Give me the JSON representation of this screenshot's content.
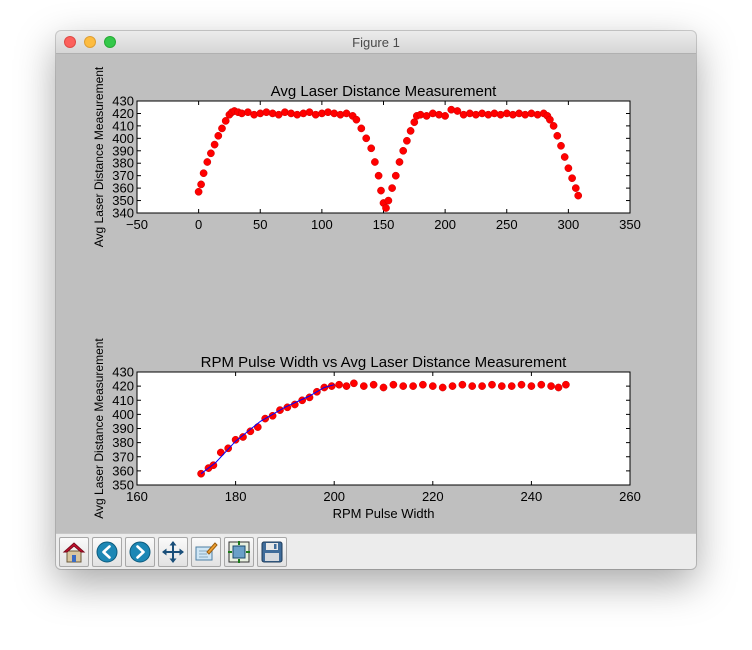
{
  "window": {
    "title": "Figure 1"
  },
  "toolbar": {
    "buttons": [
      {
        "name": "home-button",
        "icon": "home-icon"
      },
      {
        "name": "back-button",
        "icon": "back-arrow-icon"
      },
      {
        "name": "forward-button",
        "icon": "forward-arrow-icon"
      },
      {
        "name": "pan-button",
        "icon": "move-arrows-icon"
      },
      {
        "name": "zoom-button",
        "icon": "zoom-rect-icon"
      },
      {
        "name": "subplots-button",
        "icon": "subplots-config-icon"
      },
      {
        "name": "save-button",
        "icon": "floppy-disk-icon"
      }
    ]
  },
  "colors": {
    "figure_bg": "#bfbfbf",
    "axes_bg": "#ffffff",
    "marker": "#ff0000",
    "fit_line": "#0000ff"
  },
  "chart_data": [
    {
      "type": "scatter",
      "title": "Avg Laser Distance Measurement",
      "xlabel": "",
      "ylabel": "Avg Laser Distance Measurement",
      "xlim": [
        -50,
        350
      ],
      "ylim": [
        340,
        430
      ],
      "xticks": [
        -50,
        0,
        50,
        100,
        150,
        200,
        250,
        300,
        350
      ],
      "yticks": [
        340,
        350,
        360,
        370,
        380,
        390,
        400,
        410,
        420,
        430
      ],
      "grid": false,
      "series": [
        {
          "marker_color": "#ff0000",
          "x": [
            0,
            2,
            4,
            7,
            10,
            13,
            16,
            19,
            22,
            25,
            27,
            29,
            32,
            35,
            40,
            45,
            50,
            55,
            60,
            65,
            70,
            75,
            80,
            85,
            90,
            95,
            100,
            105,
            110,
            115,
            120,
            125,
            128,
            132,
            136,
            140,
            143,
            146,
            148,
            150,
            152,
            154,
            157,
            160,
            163,
            166,
            169,
            172,
            175,
            177,
            180,
            185,
            190,
            195,
            200,
            205,
            210,
            215,
            220,
            225,
            230,
            235,
            240,
            245,
            250,
            255,
            260,
            265,
            270,
            275,
            280,
            283,
            285,
            288,
            291,
            294,
            297,
            300,
            303,
            306,
            308
          ],
          "y": [
            357,
            363,
            372,
            381,
            388,
            395,
            402,
            408,
            414,
            419,
            421,
            422,
            421,
            420,
            421,
            419,
            420,
            421,
            420,
            419,
            421,
            420,
            419,
            420,
            421,
            419,
            420,
            421,
            420,
            419,
            420,
            418,
            415,
            408,
            400,
            392,
            381,
            370,
            358,
            348,
            344,
            350,
            360,
            370,
            381,
            390,
            398,
            406,
            413,
            418,
            419,
            418,
            420,
            419,
            418,
            423,
            422,
            419,
            420,
            419,
            420,
            419,
            420,
            419,
            420,
            419,
            420,
            419,
            420,
            419,
            420,
            418,
            415,
            410,
            402,
            394,
            385,
            376,
            368,
            360,
            354
          ]
        }
      ]
    },
    {
      "type": "scatter",
      "title": "RPM Pulse Width vs Avg Laser Distance Measurement",
      "xlabel": "RPM Pulse Width",
      "ylabel": "Avg Laser Distance Measurement",
      "xlim": [
        160,
        260
      ],
      "ylim": [
        350,
        430
      ],
      "xticks": [
        160,
        180,
        200,
        220,
        240,
        260
      ],
      "yticks": [
        350,
        360,
        370,
        380,
        390,
        400,
        410,
        420,
        430
      ],
      "grid": false,
      "series": [
        {
          "marker_color": "#ff0000",
          "x": [
            173,
            174.5,
            175.5,
            177,
            178.5,
            180,
            181.5,
            183,
            184.5,
            186,
            187.5,
            189,
            190.5,
            192,
            193.5,
            195,
            196.5,
            198,
            199.5,
            201,
            202.5,
            204,
            206,
            208,
            210,
            212,
            214,
            216,
            218,
            220,
            222,
            224,
            226,
            228,
            230,
            232,
            234,
            236,
            238,
            240,
            242,
            244,
            245.5,
            247
          ],
          "y": [
            358,
            362,
            364,
            373,
            376,
            382,
            384,
            388,
            391,
            397,
            399,
            403,
            405,
            407,
            410,
            412,
            416,
            419,
            420,
            421,
            420,
            422,
            420,
            421,
            419,
            421,
            420,
            420,
            421,
            420,
            419,
            420,
            421,
            420,
            420,
            421,
            420,
            420,
            421,
            420,
            421,
            420,
            419,
            421
          ]
        },
        {
          "line_color": "#0000ff",
          "x": [
            173,
            176,
            180,
            185,
            190,
            195,
            198,
            200
          ],
          "y": [
            358,
            366,
            381,
            395,
            405,
            413,
            419,
            421
          ]
        }
      ]
    }
  ]
}
